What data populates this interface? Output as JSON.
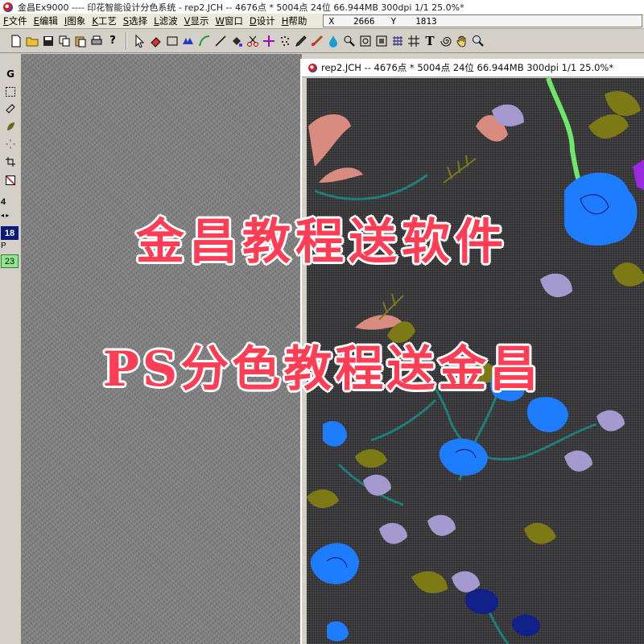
{
  "window": {
    "title": "金昌Ex9000 ---- 印花智能设计分色系统 - rep2.JCH -- 4676点 * 5004点 24位  66.944MB 300dpi 1/1  25.0%*"
  },
  "menu": {
    "items": [
      {
        "key": "F",
        "label": "文件"
      },
      {
        "key": "E",
        "label": "编辑"
      },
      {
        "key": "I",
        "label": "图象"
      },
      {
        "key": "K",
        "label": "工艺"
      },
      {
        "key": "S",
        "label": "选择"
      },
      {
        "key": "L",
        "label": "滤波"
      },
      {
        "key": "V",
        "label": "显示"
      },
      {
        "key": "W",
        "label": "窗口"
      },
      {
        "key": "D",
        "label": "设计"
      },
      {
        "key": "H",
        "label": "帮助"
      }
    ]
  },
  "coords": {
    "x_label": "X",
    "x_value": "2666",
    "y_label": "Y",
    "y_value": "1813"
  },
  "toolbar": {
    "help_glyph": "?",
    "text_tool_glyph": "T"
  },
  "palette": {
    "g_label": "G",
    "size_value": "4",
    "color_index_1": "18",
    "p_label": "P",
    "color_index_2": "23"
  },
  "document": {
    "title": "rep2.JCH -- 4676点 * 5004点 24位  66.944MB 300dpi 1/1  25.0%*"
  },
  "overlay": {
    "line1": "金昌教程送软件",
    "line2": "PS分色教程送金昌",
    "color": "#ff3d55"
  },
  "colors": {
    "canvas_gray": "#7d7d7d",
    "design_bg": "#3a3a3c",
    "flower_blue": "#1e7cff",
    "flower_navy": "#12208a",
    "leaf_olive": "#7d7a16",
    "leaf_lavender": "#a59ad0",
    "petal_salmon": "#d98b80",
    "stem_teal": "#1f7f78",
    "stem_green": "#6ee86a"
  }
}
